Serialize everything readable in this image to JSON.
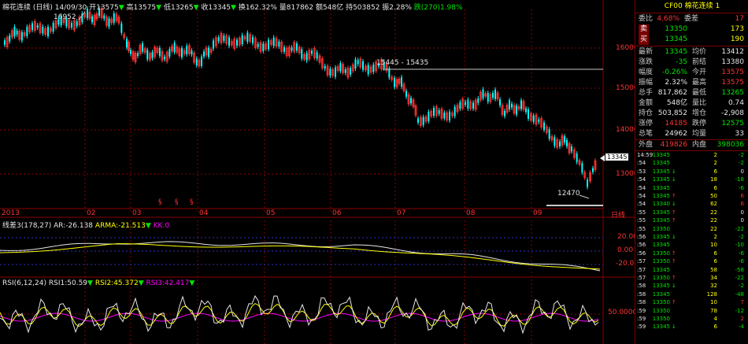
{
  "header": {
    "symbol_name": "棉花连续",
    "period": "(日线)",
    "date": "14/09/30",
    "open": "开13575",
    "high": "高13575",
    "low": "低13265",
    "close": "收13345",
    "turnover_rate": "换162.32%",
    "volume": "量817862",
    "amount": "额548亿",
    "open_interest": "持503852",
    "amplitude": "振2.28%",
    "drop": "跌(270)1.98%"
  },
  "main_chart": {
    "annotations": {
      "high_label": "16952",
      "low_label": "12470",
      "range_label": "15445 - 15435",
      "last_price_tag": "13345",
      "marker_char": "§"
    },
    "price_axis": [
      "16000",
      "15000",
      "14000",
      "13000"
    ],
    "x_labels": [
      "2013",
      "02",
      "03",
      "04",
      "05",
      "06",
      "07",
      "08",
      "09"
    ],
    "x_unit": "日线",
    "colors": {
      "up": "#ff3232",
      "down": "#00ffff",
      "grid": "#8b0000"
    }
  },
  "macd_panel": {
    "title": "线差3(178,27)",
    "ar": "AR:-26.138",
    "arma": "ARMA:-21.513",
    "kk": "KK:0",
    "axis": [
      "20.00",
      "0.00",
      "-20.00"
    ]
  },
  "rsi_panel": {
    "title": "RSI(6,12,24)",
    "rsi1": "RSI1:50.59",
    "rsi2": "RSI2:45.372",
    "rsi3": "RSI3:42.417",
    "axis": [
      "50.00000"
    ]
  },
  "panel": {
    "code": "CF00",
    "name": "棉花连续",
    "index": "1",
    "committee_ratio_label": "委比",
    "committee_ratio": "4.68%",
    "committee_diff_label": "委差",
    "committee_diff": "17",
    "sell_label": "卖",
    "sell_price": "13350",
    "sell_vol": "173",
    "buy_label": "买",
    "buy_price": "13345",
    "buy_vol": "190",
    "stats": [
      {
        "l1": "最新",
        "v1": "13345",
        "c1": "dn",
        "l2": "均价",
        "v2": "13412",
        "c2": "wh"
      },
      {
        "l1": "涨跌",
        "v1": "-35",
        "c1": "dn",
        "l2": "前结",
        "v2": "13380",
        "c2": "wh"
      },
      {
        "l1": "幅度",
        "v1": "-0.26%",
        "c1": "dn",
        "l2": "今开",
        "v2": "13575",
        "c2": "up"
      },
      {
        "l1": "振幅",
        "v1": "2.32%",
        "c1": "wh",
        "l2": "最高",
        "v2": "13575",
        "c2": "up"
      },
      {
        "l1": "总手",
        "v1": "817,862",
        "c1": "wh",
        "l2": "最低",
        "v2": "13265",
        "c2": "dn"
      },
      {
        "l1": "金额",
        "v1": "548亿",
        "c1": "wh",
        "l2": "量比",
        "v2": "0.74",
        "c2": "wh"
      },
      {
        "l1": "持仓",
        "v1": "503,852",
        "c1": "wh",
        "l2": "增仓",
        "v2": "-2,908",
        "c2": "wh"
      },
      {
        "l1": "涨停",
        "v1": "14185",
        "c1": "up",
        "l2": "跌停",
        "v2": "12575",
        "c2": "dn"
      },
      {
        "l1": "总笔",
        "v1": "24962",
        "c1": "wh",
        "l2": "均量",
        "v2": "33",
        "c2": "wh"
      }
    ],
    "outer_label": "外盘",
    "outer_value": "419826",
    "inner_label": "内盘",
    "inner_value": "398036",
    "ticks": [
      {
        "t": "14:59",
        "p": "13345",
        "pc": "dn",
        "a": "",
        "v": "2",
        "d": "-2"
      },
      {
        "t": ":54",
        "p": "13345",
        "pc": "dn",
        "a": "",
        "v": "2",
        "d": "-2"
      },
      {
        "t": ":53",
        "p": "13345",
        "pc": "dn",
        "a": "↓",
        "v": "6",
        "d": "0"
      },
      {
        "t": ":54",
        "p": "13345",
        "pc": "dn",
        "a": "↓",
        "v": "18",
        "d": "-18"
      },
      {
        "t": ":54",
        "p": "13345",
        "pc": "dn",
        "a": "",
        "v": "6",
        "d": "-6"
      },
      {
        "t": ":54",
        "p": "13345",
        "pc": "dn",
        "a": "↑",
        "v": "50",
        "d": "6"
      },
      {
        "t": ":54",
        "p": "13340",
        "pc": "dn",
        "a": "↓",
        "v": "62",
        "d": "6"
      },
      {
        "t": ":55",
        "p": "13345",
        "pc": "dn",
        "a": "↑",
        "v": "22",
        "d": "0"
      },
      {
        "t": ":55",
        "p": "13345",
        "pc": "dn",
        "a": "↑",
        "v": "22",
        "d": "0"
      },
      {
        "t": ":55",
        "p": "13350",
        "pc": "dn",
        "a": "",
        "v": "22",
        "d": "-22"
      },
      {
        "t": ":56",
        "p": "13345",
        "pc": "dn",
        "a": "↓",
        "v": "2",
        "d": "-2"
      },
      {
        "t": ":56",
        "p": "13345",
        "pc": "dn",
        "a": "",
        "v": "10",
        "d": "-10"
      },
      {
        "t": ":56",
        "p": "13350",
        "pc": "dn",
        "a": "↑",
        "v": "6",
        "d": "-6"
      },
      {
        "t": ":57",
        "p": "13350",
        "pc": "dn",
        "a": "↑",
        "v": "6",
        "d": "-6"
      },
      {
        "t": ":57",
        "p": "13345",
        "pc": "dn",
        "a": "",
        "v": "58",
        "d": "-58"
      },
      {
        "t": ":57",
        "p": "13350",
        "pc": "dn",
        "a": "↑",
        "v": "34",
        "d": "-22"
      },
      {
        "t": ":58",
        "p": "13345",
        "pc": "dn",
        "a": "↓",
        "v": "32",
        "d": "-2"
      },
      {
        "t": ":58",
        "p": "13345",
        "pc": "dn",
        "a": "",
        "v": "128",
        "d": "-48"
      },
      {
        "t": ":58",
        "p": "13350",
        "pc": "dn",
        "a": "↑",
        "v": "10",
        "d": "7"
      },
      {
        "t": ":59",
        "p": "13350",
        "pc": "dn",
        "a": "",
        "v": "78",
        "d": "-12"
      },
      {
        "t": ":59",
        "p": "13350",
        "pc": "dn",
        "a": "",
        "v": "4",
        "d": "2"
      },
      {
        "t": ":59",
        "p": "13345",
        "pc": "dn",
        "a": "↓",
        "v": "6",
        "d": "-4"
      }
    ]
  }
}
